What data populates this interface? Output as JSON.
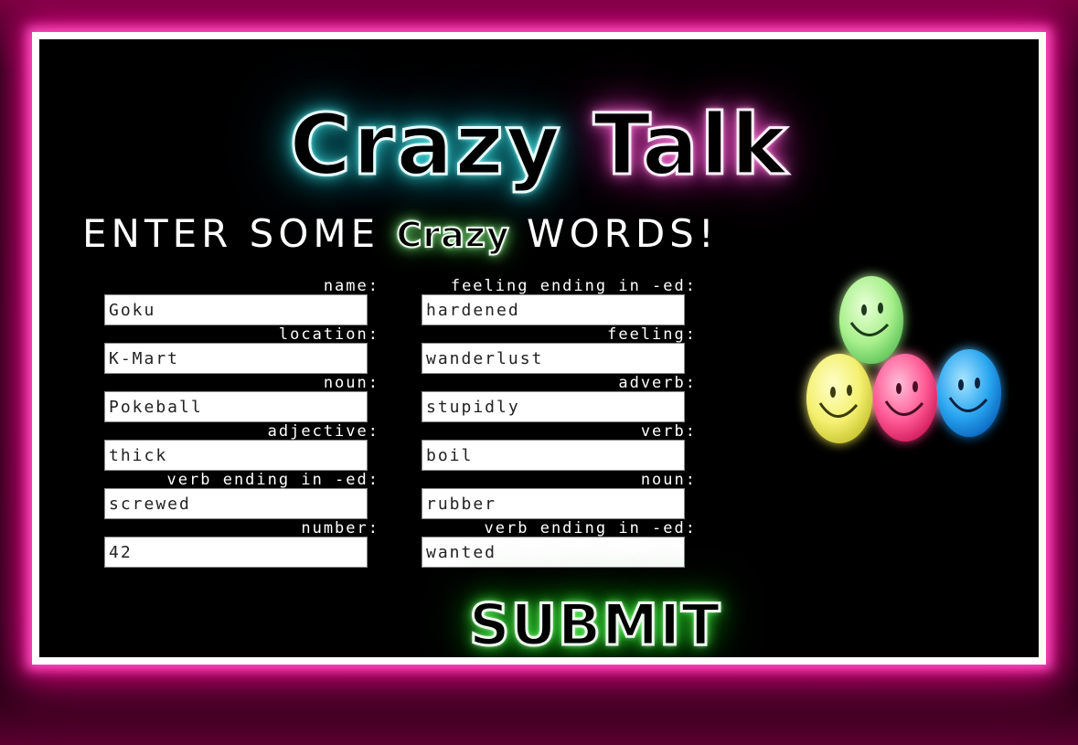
{
  "title": {
    "word1": "Crazy",
    "word2": "Talk"
  },
  "subtitle": {
    "before": "ENTER SOME ",
    "crazy": "Crazy",
    "after": " WORDS!"
  },
  "form": {
    "left": [
      {
        "label": "name:",
        "value": "Goku"
      },
      {
        "label": "location:",
        "value": "K-Mart"
      },
      {
        "label": "noun:",
        "value": "Pokeball"
      },
      {
        "label": "adjective:",
        "value": "thick"
      },
      {
        "label": "verb ending in -ed:",
        "value": "screwed"
      },
      {
        "label": "number:",
        "value": "42"
      }
    ],
    "right": [
      {
        "label": "feeling ending in -ed:",
        "value": "hardened"
      },
      {
        "label": "feeling:",
        "value": "wanderlust"
      },
      {
        "label": "adverb:",
        "value": "stupidly"
      },
      {
        "label": "verb:",
        "value": "boil"
      },
      {
        "label": "noun:",
        "value": "rubber"
      },
      {
        "label": "verb ending in -ed:",
        "value": "wanted"
      }
    ]
  },
  "submit_label": "SUBMIT",
  "colors": {
    "frame_glow": "#d4007a",
    "title_word1_glow": "#38e0e0",
    "title_word2_glow": "#ff6ad6",
    "submit_glow": "#44ff44"
  },
  "decoration": {
    "image": "glowing-smiley-balls-icon",
    "smileys": [
      "green",
      "yellow",
      "pink",
      "blue"
    ]
  }
}
